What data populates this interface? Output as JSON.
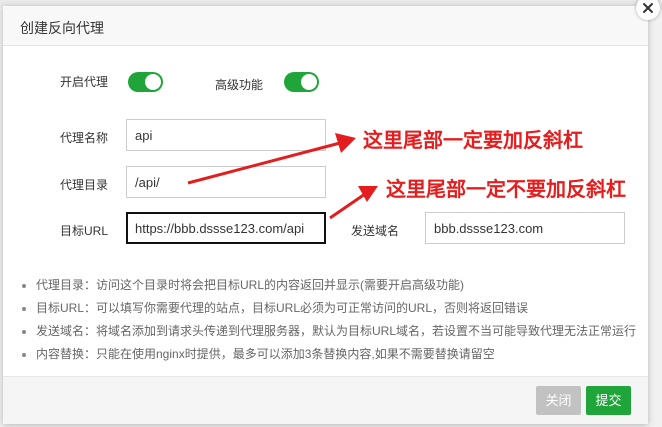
{
  "dialog": {
    "title": "创建反向代理",
    "close_icon": "close-icon"
  },
  "form": {
    "enable_proxy_label": "开启代理",
    "enable_proxy_on": true,
    "advanced_label": "高级功能",
    "advanced_on": true,
    "proxy_name_label": "代理名称",
    "proxy_name_value": "api",
    "proxy_dir_label": "代理目录",
    "proxy_dir_value": "/api/",
    "target_url_label": "目标URL",
    "target_url_value": "https://bbb.dssse123.com/api",
    "send_domain_label": "发送域名",
    "send_domain_value": "bbb.dssse123.com"
  },
  "tips": [
    "代理目录：访问这个目录时将会把目标URL的内容返回并显示(需要开启高级功能)",
    "目标URL：可以填写你需要代理的站点，目标URL必须为可正常访问的URL，否则将返回错误",
    "发送域名：将域名添加到请求头传递到代理服务器，默认为目标URL域名，若设置不当可能导致代理无法正常运行",
    "内容替换：只能在使用nginx时提供，最多可以添加3条替换内容,如果不需要替换请留空"
  ],
  "footer": {
    "close_label": "关闭",
    "submit_label": "提交"
  },
  "annotations": {
    "top": "这里尾部一定要加反斜杠",
    "bottom": "这里尾部一定不要加反斜杠",
    "color": "#e41e1e"
  },
  "colors": {
    "accent": "#20a53a",
    "disabled": "#c2c2c2"
  }
}
